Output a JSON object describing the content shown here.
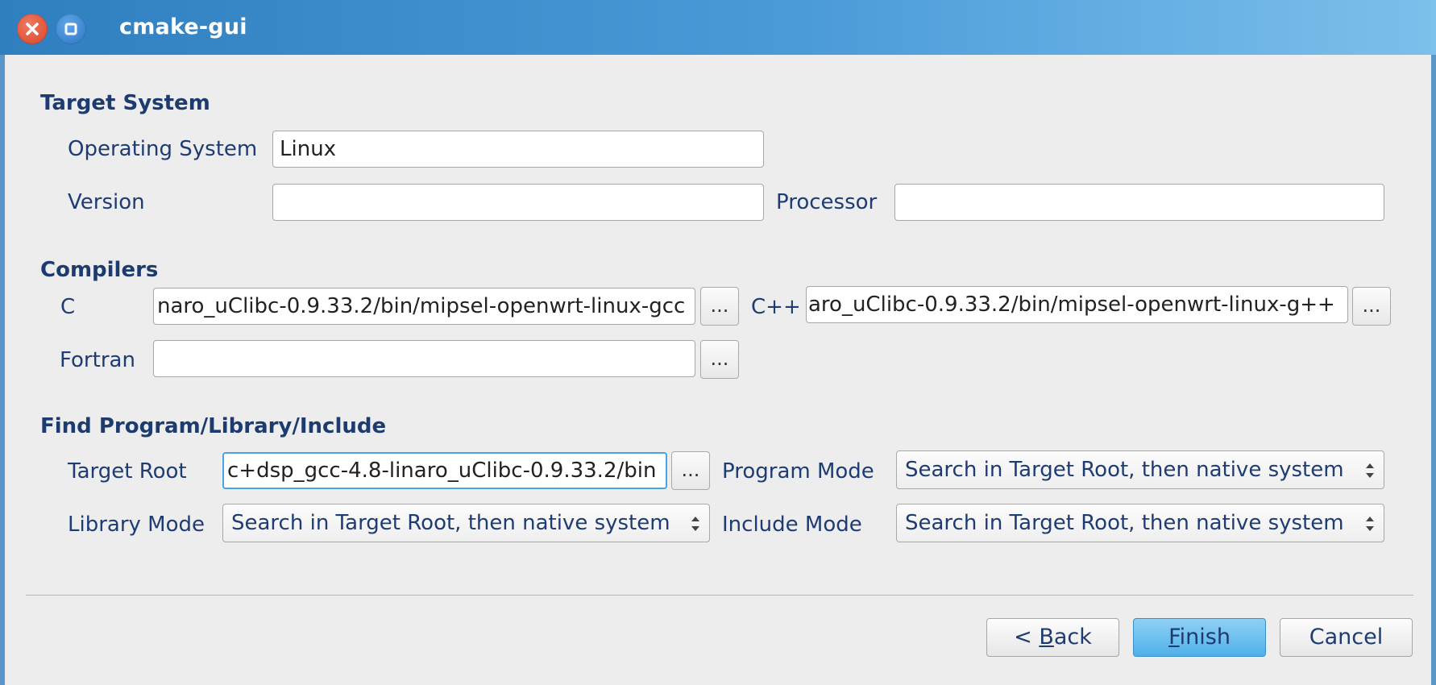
{
  "window": {
    "title": "cmake-gui",
    "close_icon": "close-icon",
    "maximize_icon": "maximize-icon"
  },
  "target_system": {
    "heading": "Target System",
    "os_label": "Operating System",
    "os_value": "Linux",
    "version_label": "Version",
    "version_value": "",
    "processor_label": "Processor",
    "processor_value": ""
  },
  "compilers": {
    "heading": "Compilers",
    "c_label": "C",
    "c_value": "naro_uClibc-0.9.33.2/bin/mipsel-openwrt-linux-gcc",
    "cxx_label": "C++",
    "cxx_value": "aro_uClibc-0.9.33.2/bin/mipsel-openwrt-linux-g++",
    "fortran_label": "Fortran",
    "fortran_value": "",
    "browse_label": "..."
  },
  "find": {
    "heading": "Find Program/Library/Include",
    "target_root_label": "Target Root",
    "target_root_value": "c+dsp_gcc-4.8-linaro_uClibc-0.9.33.2/bin",
    "program_mode_label": "Program Mode",
    "program_mode_value": "Search in Target Root, then native system",
    "library_mode_label": "Library Mode",
    "library_mode_value": "Search in Target Root, then native system",
    "include_mode_label": "Include Mode",
    "include_mode_value": "Search in Target Root, then native system",
    "browse_label": "..."
  },
  "buttons": {
    "back_prefix": "< ",
    "back_mnemonic": "B",
    "back_rest": "ack",
    "finish_mnemonic": "F",
    "finish_rest": "inish",
    "cancel": "Cancel"
  },
  "colors": {
    "titlebar_start": "#2f7fc0",
    "titlebar_end": "#7cc0ec",
    "default_button": "#4fb1ea",
    "focus_border": "#48a4e2"
  }
}
